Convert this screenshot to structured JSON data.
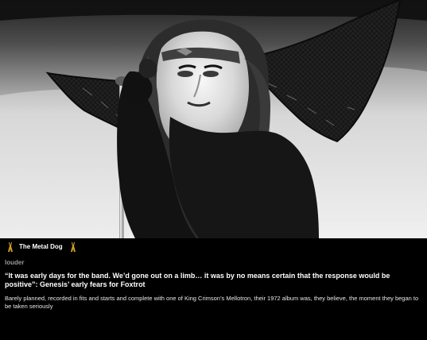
{
  "window": {
    "title": ""
  },
  "hero": {
    "image_label": "",
    "tones": {
      "backdrop_top": "#2a2a2a",
      "backdrop_mid": "#585858",
      "backdrop_light": "#cfcfcf",
      "backdrop_bottom": "#f1f1f1",
      "subject_dark": "#161616"
    }
  },
  "source": {
    "name": "The Metal Dog",
    "icon_left": "metal-horns-icon",
    "icon_right": "metal-horns-icon",
    "accent_color": "#d2a126"
  },
  "article": {
    "publisher": "louder",
    "headline": "“It was early days for the band. We’d gone out on a limb… it was by no means certain that the response would be positive”: Genesis’ early fears for Foxtrot",
    "description": "Barely planned, recorded in fits and starts and complete with one of King Crimson’s Mellotron, their 1972 album was, they believe, the moment they began to be taken seriously"
  },
  "colors": {
    "background": "#000000",
    "headline_text": "#ffffff",
    "publisher_text": "#9a9a9a",
    "description_text": "#e7e7e7"
  }
}
